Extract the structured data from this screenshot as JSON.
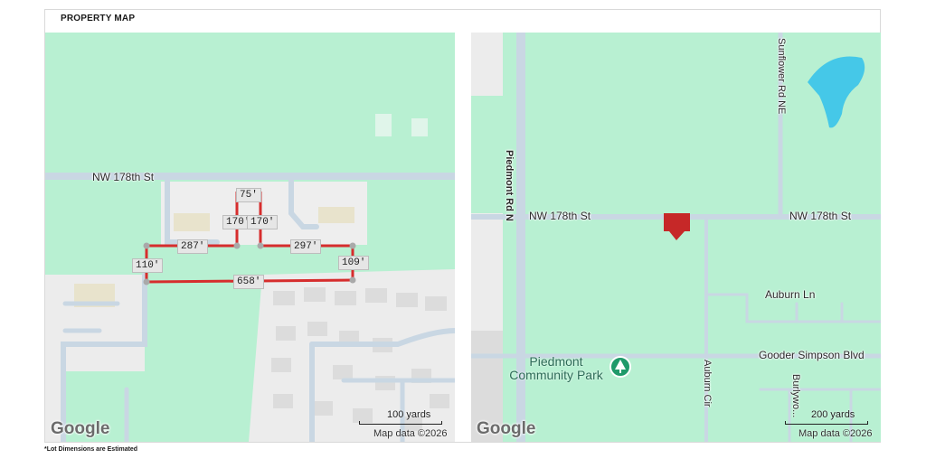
{
  "header": {
    "title": "PROPERTY MAP"
  },
  "footnote": "*Lot Dimensions are Estimated",
  "left_map": {
    "streets": [
      "NW 178th St"
    ],
    "dimensions": [
      "75'",
      "170'",
      "170'",
      "287'",
      "297'",
      "110'",
      "109'",
      "658'"
    ],
    "scale_label": "100 yards",
    "attribution": "Map data ©2026",
    "logo": "Google",
    "colors": {
      "line": "#d62d2d",
      "park": "#b8f0d2",
      "road": "#c9d7e3"
    }
  },
  "right_map": {
    "streets": {
      "piedmont": "Piedmont Rd N",
      "sunflower": "Sunflower Rd NE",
      "nw178_left": "NW 178th St",
      "nw178_right": "NW 178th St",
      "auburn_ln": "Auburn Ln",
      "gooder": "Gooder Simpson Blvd",
      "auburn_cir": "Auburn Cir",
      "burlywood": "Burlywo..."
    },
    "poi": "Piedmont Community Park",
    "scale_label": "200 yards",
    "attribution": "Map data ©2026",
    "logo": "Google",
    "colors": {
      "marker": "#c62828",
      "water": "#45c8e8",
      "poi": "#1f9a6a"
    }
  }
}
